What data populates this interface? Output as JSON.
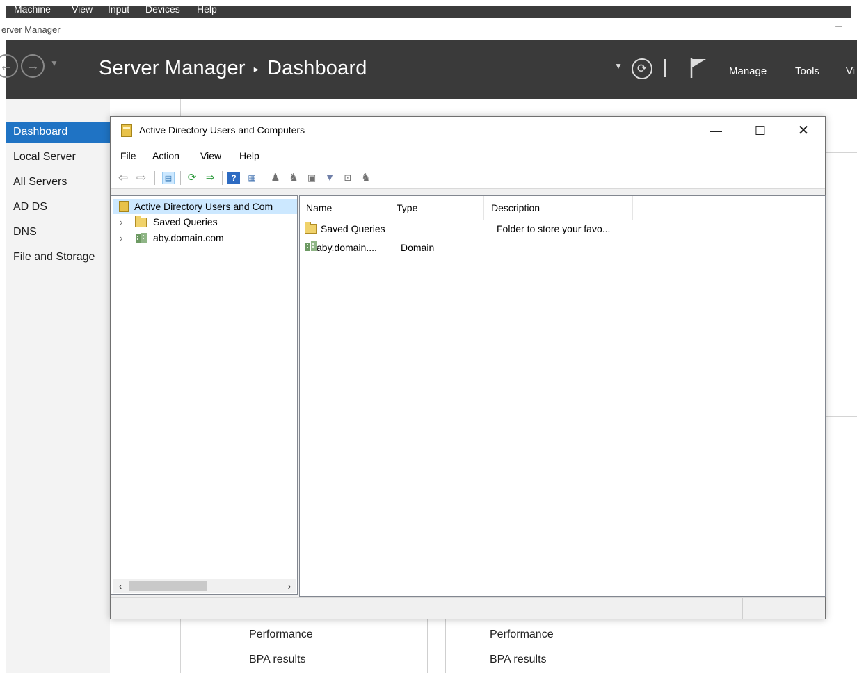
{
  "vm_menu": [
    "Machine",
    "View",
    "Input",
    "Devices",
    "Help"
  ],
  "server_manager": {
    "window_title": "erver Manager",
    "breadcrumb": {
      "app": "Server Manager",
      "page": "Dashboard"
    },
    "header_menu": [
      "Manage",
      "Tools",
      "Vi"
    ],
    "sidebar": [
      {
        "label": "Dashboard",
        "active": true
      },
      {
        "label": "Local Server",
        "active": false
      },
      {
        "label": "All Servers",
        "active": false
      },
      {
        "label": "AD DS",
        "active": false
      },
      {
        "label": "DNS",
        "active": false
      },
      {
        "label": "File and Storage",
        "active": false
      }
    ],
    "bottom_left": [
      "Performance",
      "BPA results"
    ],
    "bottom_right": [
      "Performance",
      "BPA results"
    ]
  },
  "aduc": {
    "title": "Active Directory Users and Computers",
    "menu": [
      "File",
      "Action",
      "View",
      "Help"
    ],
    "tree": {
      "root": "Active Directory Users and Com",
      "children": [
        "Saved Queries",
        "aby.domain.com"
      ]
    },
    "columns": [
      "Name",
      "Type",
      "Description"
    ],
    "rows": [
      {
        "name": "Saved Queries",
        "type": "",
        "description": "Folder to store your favo...",
        "icon": "folder-icon"
      },
      {
        "name": "aby.domain....",
        "type": "Domain",
        "description": "",
        "icon": "domain-icon"
      }
    ],
    "toolbar_icons": [
      "back-icon",
      "forward-icon",
      "show-console-tree-icon",
      "refresh-icon",
      "export-list-icon",
      "help-icon",
      "show-action-pane-icon",
      "new-user-icon",
      "new-group-icon",
      "new-ou-icon",
      "filter-icon",
      "find-icon",
      "add-to-group-icon"
    ]
  }
}
